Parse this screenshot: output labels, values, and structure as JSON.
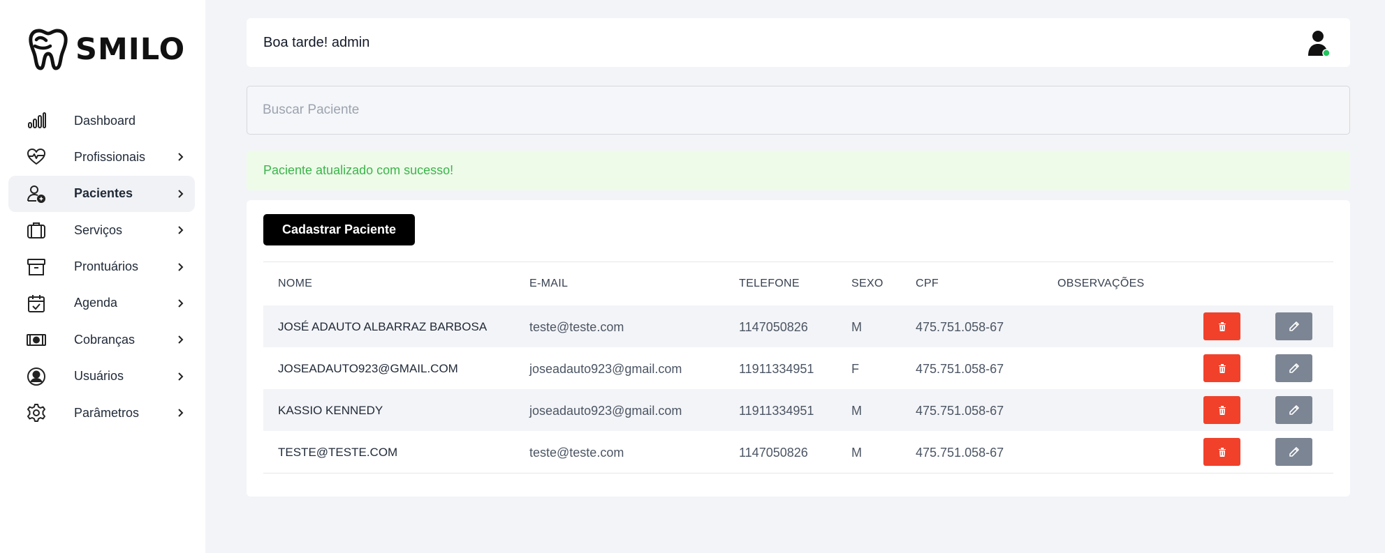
{
  "brand": {
    "name": "SMILO"
  },
  "sidebar": {
    "items": [
      {
        "label": "Dashboard",
        "icon": "bar-chart-icon",
        "chevron": false,
        "active": false
      },
      {
        "label": "Profissionais",
        "icon": "heart-pulse-icon",
        "chevron": true,
        "active": false
      },
      {
        "label": "Pacientes",
        "icon": "user-add-icon",
        "chevron": true,
        "active": true
      },
      {
        "label": "Serviços",
        "icon": "briefcase-icon",
        "chevron": true,
        "active": false
      },
      {
        "label": "Prontuários",
        "icon": "archive-icon",
        "chevron": true,
        "active": false
      },
      {
        "label": "Agenda",
        "icon": "calendar-check-icon",
        "chevron": true,
        "active": false
      },
      {
        "label": "Cobranças",
        "icon": "money-icon",
        "chevron": true,
        "active": false
      },
      {
        "label": "Usuários",
        "icon": "user-circle-icon",
        "chevron": true,
        "active": false
      },
      {
        "label": "Parâmetros",
        "icon": "gear-icon",
        "chevron": true,
        "active": false
      }
    ]
  },
  "header": {
    "greeting": "Boa tarde! admin",
    "status_color": "#22c55e"
  },
  "search": {
    "placeholder": "Buscar Paciente",
    "value": ""
  },
  "alert": {
    "message": "Paciente atualizado com sucesso!"
  },
  "main": {
    "add_button_label": "Cadastrar Paciente",
    "table": {
      "columns": [
        "NOME",
        "E-MAIL",
        "TELEFONE",
        "SEXO",
        "CPF",
        "OBSERVAÇÕES"
      ],
      "rows": [
        {
          "nome": "JOSÉ ADAUTO ALBARRAZ BARBOSA",
          "email": "teste@teste.com",
          "telefone": "1147050826",
          "sexo": "M",
          "cpf": "475.751.058-67",
          "obs": ""
        },
        {
          "nome": "JOSEADAUTO923@GMAIL.COM",
          "email": "joseadauto923@gmail.com",
          "telefone": "11911334951",
          "sexo": "F",
          "cpf": "475.751.058-67",
          "obs": ""
        },
        {
          "nome": "KASSIO KENNEDY",
          "email": "joseadauto923@gmail.com",
          "telefone": "11911334951",
          "sexo": "M",
          "cpf": "475.751.058-67",
          "obs": ""
        },
        {
          "nome": "TESTE@TESTE.COM",
          "email": "teste@teste.com",
          "telefone": "1147050826",
          "sexo": "M",
          "cpf": "475.751.058-67",
          "obs": ""
        }
      ]
    }
  },
  "colors": {
    "delete": "#f1412a",
    "edit": "#7c8593",
    "success_text": "#3bb54a",
    "success_bg": "#eefbe9"
  }
}
